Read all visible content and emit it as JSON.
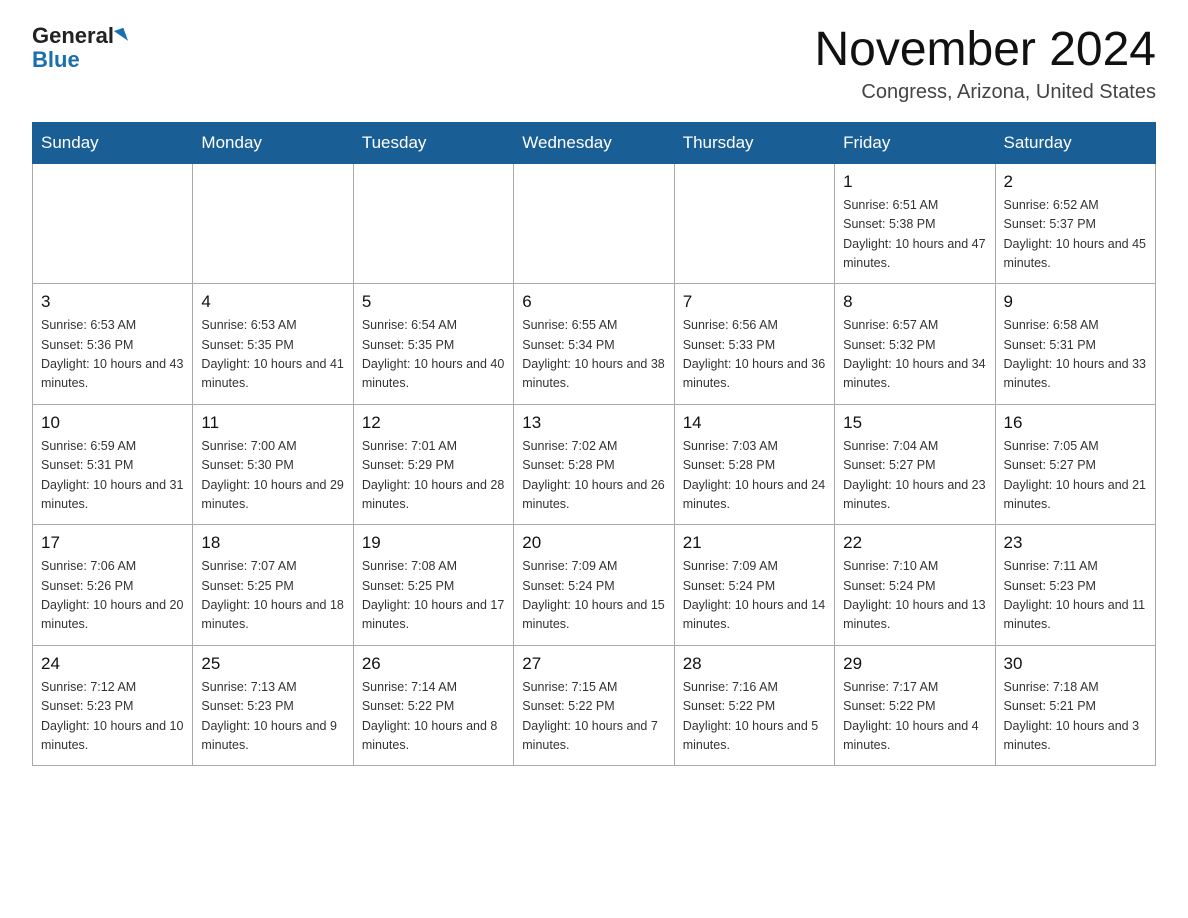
{
  "header": {
    "logo_general": "General",
    "logo_blue": "Blue",
    "month_title": "November 2024",
    "location": "Congress, Arizona, United States"
  },
  "days_of_week": [
    "Sunday",
    "Monday",
    "Tuesday",
    "Wednesday",
    "Thursday",
    "Friday",
    "Saturday"
  ],
  "weeks": [
    [
      {
        "day": "",
        "info": ""
      },
      {
        "day": "",
        "info": ""
      },
      {
        "day": "",
        "info": ""
      },
      {
        "day": "",
        "info": ""
      },
      {
        "day": "",
        "info": ""
      },
      {
        "day": "1",
        "info": "Sunrise: 6:51 AM\nSunset: 5:38 PM\nDaylight: 10 hours and 47 minutes."
      },
      {
        "day": "2",
        "info": "Sunrise: 6:52 AM\nSunset: 5:37 PM\nDaylight: 10 hours and 45 minutes."
      }
    ],
    [
      {
        "day": "3",
        "info": "Sunrise: 6:53 AM\nSunset: 5:36 PM\nDaylight: 10 hours and 43 minutes."
      },
      {
        "day": "4",
        "info": "Sunrise: 6:53 AM\nSunset: 5:35 PM\nDaylight: 10 hours and 41 minutes."
      },
      {
        "day": "5",
        "info": "Sunrise: 6:54 AM\nSunset: 5:35 PM\nDaylight: 10 hours and 40 minutes."
      },
      {
        "day": "6",
        "info": "Sunrise: 6:55 AM\nSunset: 5:34 PM\nDaylight: 10 hours and 38 minutes."
      },
      {
        "day": "7",
        "info": "Sunrise: 6:56 AM\nSunset: 5:33 PM\nDaylight: 10 hours and 36 minutes."
      },
      {
        "day": "8",
        "info": "Sunrise: 6:57 AM\nSunset: 5:32 PM\nDaylight: 10 hours and 34 minutes."
      },
      {
        "day": "9",
        "info": "Sunrise: 6:58 AM\nSunset: 5:31 PM\nDaylight: 10 hours and 33 minutes."
      }
    ],
    [
      {
        "day": "10",
        "info": "Sunrise: 6:59 AM\nSunset: 5:31 PM\nDaylight: 10 hours and 31 minutes."
      },
      {
        "day": "11",
        "info": "Sunrise: 7:00 AM\nSunset: 5:30 PM\nDaylight: 10 hours and 29 minutes."
      },
      {
        "day": "12",
        "info": "Sunrise: 7:01 AM\nSunset: 5:29 PM\nDaylight: 10 hours and 28 minutes."
      },
      {
        "day": "13",
        "info": "Sunrise: 7:02 AM\nSunset: 5:28 PM\nDaylight: 10 hours and 26 minutes."
      },
      {
        "day": "14",
        "info": "Sunrise: 7:03 AM\nSunset: 5:28 PM\nDaylight: 10 hours and 24 minutes."
      },
      {
        "day": "15",
        "info": "Sunrise: 7:04 AM\nSunset: 5:27 PM\nDaylight: 10 hours and 23 minutes."
      },
      {
        "day": "16",
        "info": "Sunrise: 7:05 AM\nSunset: 5:27 PM\nDaylight: 10 hours and 21 minutes."
      }
    ],
    [
      {
        "day": "17",
        "info": "Sunrise: 7:06 AM\nSunset: 5:26 PM\nDaylight: 10 hours and 20 minutes."
      },
      {
        "day": "18",
        "info": "Sunrise: 7:07 AM\nSunset: 5:25 PM\nDaylight: 10 hours and 18 minutes."
      },
      {
        "day": "19",
        "info": "Sunrise: 7:08 AM\nSunset: 5:25 PM\nDaylight: 10 hours and 17 minutes."
      },
      {
        "day": "20",
        "info": "Sunrise: 7:09 AM\nSunset: 5:24 PM\nDaylight: 10 hours and 15 minutes."
      },
      {
        "day": "21",
        "info": "Sunrise: 7:09 AM\nSunset: 5:24 PM\nDaylight: 10 hours and 14 minutes."
      },
      {
        "day": "22",
        "info": "Sunrise: 7:10 AM\nSunset: 5:24 PM\nDaylight: 10 hours and 13 minutes."
      },
      {
        "day": "23",
        "info": "Sunrise: 7:11 AM\nSunset: 5:23 PM\nDaylight: 10 hours and 11 minutes."
      }
    ],
    [
      {
        "day": "24",
        "info": "Sunrise: 7:12 AM\nSunset: 5:23 PM\nDaylight: 10 hours and 10 minutes."
      },
      {
        "day": "25",
        "info": "Sunrise: 7:13 AM\nSunset: 5:23 PM\nDaylight: 10 hours and 9 minutes."
      },
      {
        "day": "26",
        "info": "Sunrise: 7:14 AM\nSunset: 5:22 PM\nDaylight: 10 hours and 8 minutes."
      },
      {
        "day": "27",
        "info": "Sunrise: 7:15 AM\nSunset: 5:22 PM\nDaylight: 10 hours and 7 minutes."
      },
      {
        "day": "28",
        "info": "Sunrise: 7:16 AM\nSunset: 5:22 PM\nDaylight: 10 hours and 5 minutes."
      },
      {
        "day": "29",
        "info": "Sunrise: 7:17 AM\nSunset: 5:22 PM\nDaylight: 10 hours and 4 minutes."
      },
      {
        "day": "30",
        "info": "Sunrise: 7:18 AM\nSunset: 5:21 PM\nDaylight: 10 hours and 3 minutes."
      }
    ]
  ]
}
